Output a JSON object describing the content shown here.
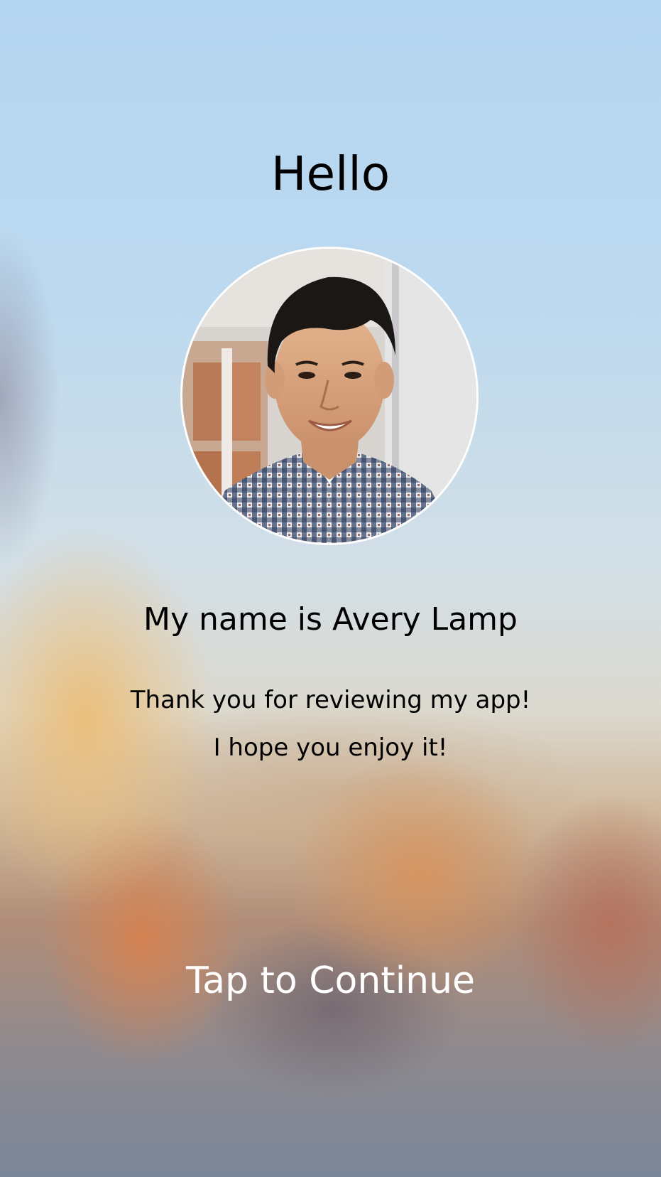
{
  "screen": {
    "greeting": "Hello",
    "name_line": "My name is Avery Lamp",
    "message_line_1": "Thank you for reviewing my app!",
    "message_line_2": "I hope you enjoy it!",
    "continue_label": "Tap to Continue"
  },
  "profile_photo": {
    "alt": "Profile photo of Avery Lamp",
    "border_color": "#ffffff"
  },
  "colors": {
    "text_dark": "#000000",
    "text_light": "#ffffff"
  }
}
